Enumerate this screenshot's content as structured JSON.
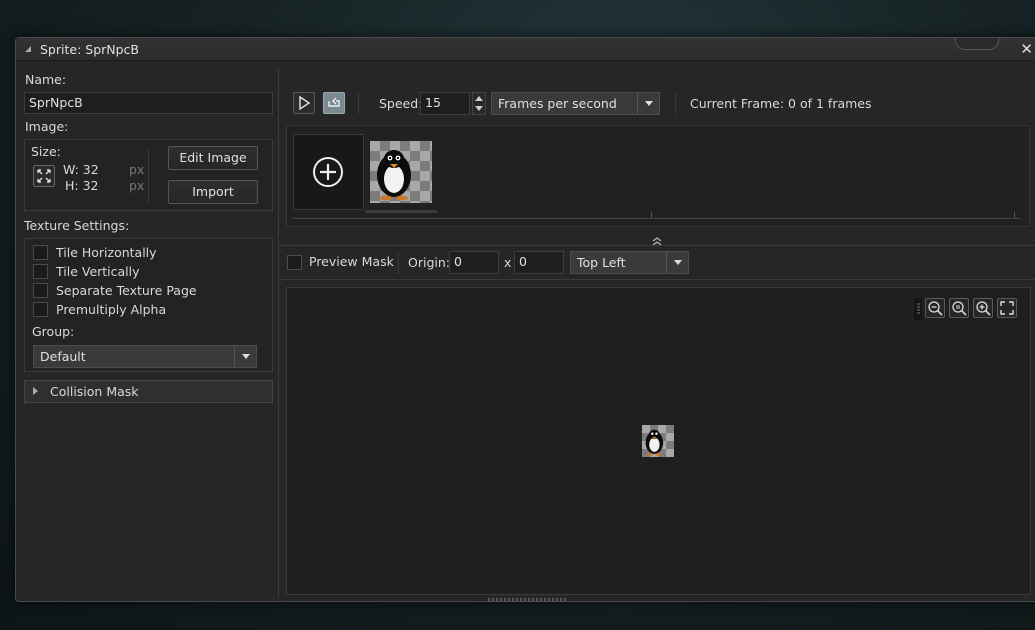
{
  "window": {
    "title": "Sprite: SprNpcB",
    "close_glyph": "✕"
  },
  "left": {
    "name_label": "Name:",
    "name_value": "SprNpcB",
    "image_label": "Image:",
    "size_label": "Size:",
    "width_text": "W: 32",
    "height_text": "H: 32",
    "unit_w": "px",
    "unit_h": "px",
    "edit_image_label": "Edit Image",
    "import_label": "Import",
    "texture_settings_label": "Texture Settings:",
    "checkboxes": [
      {
        "label": "Tile Horizontally",
        "checked": false
      },
      {
        "label": "Tile Vertically",
        "checked": false
      },
      {
        "label": "Separate Texture Page",
        "checked": false
      },
      {
        "label": "Premultiply Alpha",
        "checked": false
      }
    ],
    "group_label": "Group:",
    "group_value": "Default",
    "collision_mask_label": "Collision Mask"
  },
  "toolbar": {
    "play_icon": "play-icon",
    "loop_icon": "loop-icon",
    "speed_label": "Speed:",
    "speed_value": "15",
    "speed_unit": "Frames per second",
    "current_frame": "Current Frame: 0 of 1 frames"
  },
  "frames": {
    "add_icon": "add-frame-icon",
    "count": 1
  },
  "origin_bar": {
    "preview_mask_label": "Preview Mask",
    "origin_label": "Origin:",
    "origin_x": "0",
    "x_separator": "x",
    "origin_y": "0",
    "origin_preset": "Top Left"
  },
  "canvas": {
    "zoom_out_icon": "zoom-out-icon",
    "zoom_reset_icon": "zoom-reset-icon",
    "zoom_in_icon": "zoom-in-icon",
    "fit_icon": "fit-to-screen-icon"
  },
  "colors": {
    "window_bg": "#262626",
    "canvas_bg": "#1f1f1f",
    "accent_active": "#7a8a93"
  }
}
